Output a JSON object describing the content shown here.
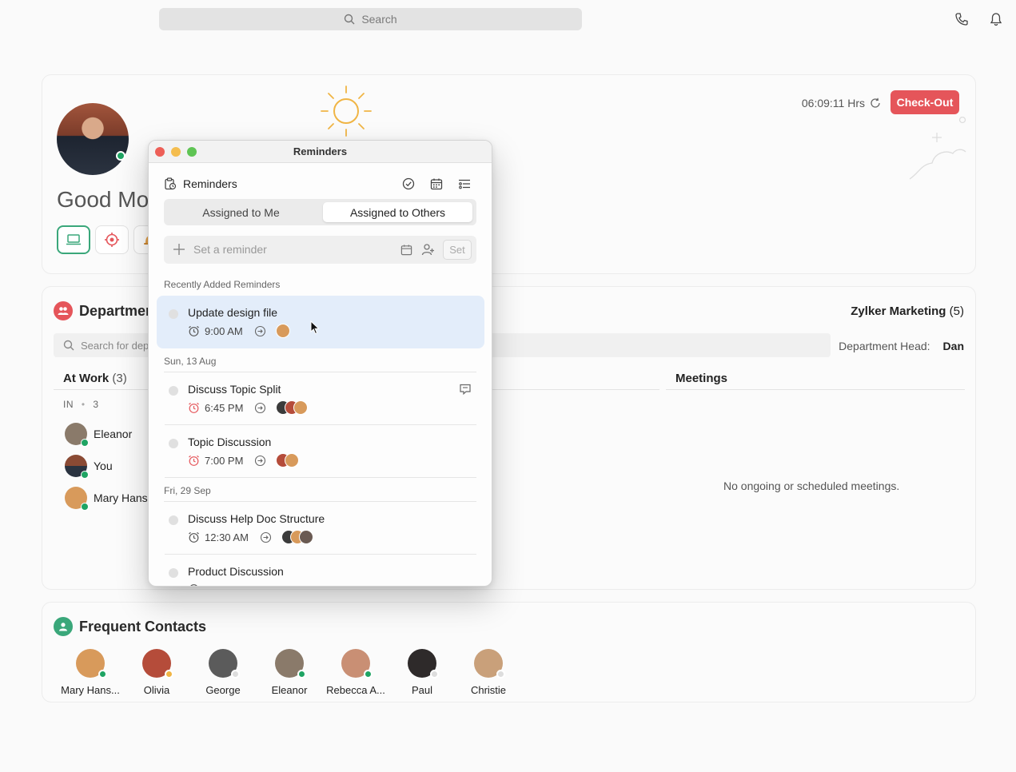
{
  "topbar": {
    "search_placeholder": "Search"
  },
  "home": {
    "greeting": "Good Mor",
    "timer": "06:09:11 Hrs",
    "checkout_label": "Check-Out"
  },
  "department": {
    "title": "Departmen",
    "name": "Zylker Marketing",
    "count": "(5)",
    "search_placeholder": "Search for depa",
    "head_label": "Department Head:",
    "head_name": "Dan",
    "at_work_label": "At Work",
    "at_work_count": "(3)",
    "in_label": "IN",
    "in_count": "3",
    "members": [
      {
        "name": "Eleanor"
      },
      {
        "name": "You"
      },
      {
        "name": "Mary Hansl"
      }
    ],
    "meetings_label": "Meetings",
    "no_meetings": "No ongoing or scheduled meetings."
  },
  "frequent_contacts": {
    "title": "Frequent Contacts",
    "contacts": [
      {
        "name": "Mary Hans...",
        "color": "#d89a5b"
      },
      {
        "name": "Olivia",
        "color": "#b54c3a"
      },
      {
        "name": "George",
        "color": "#5b5b5b"
      },
      {
        "name": "Eleanor",
        "color": "#8a7a6a"
      },
      {
        "name": "Rebecca A...",
        "color": "#c98f74"
      },
      {
        "name": "Paul",
        "color": "#2e2a2a"
      },
      {
        "name": "Christie",
        "color": "#c9a07a"
      }
    ]
  },
  "reminders": {
    "window_title": "Reminders",
    "header_label": "Reminders",
    "tab_me": "Assigned to Me",
    "tab_others": "Assigned to Others",
    "set_placeholder": "Set a reminder",
    "set_button": "Set",
    "recent_label": "Recently Added Reminders",
    "recent": {
      "title": "Update design file",
      "time": "9:00 AM"
    },
    "groups": [
      {
        "date": "Sun, 13 Aug",
        "items": [
          {
            "title": "Discuss Topic Split",
            "time": "6:45 PM"
          },
          {
            "title": "Topic Discussion",
            "time": "7:00 PM"
          }
        ]
      },
      {
        "date": "Fri, 29 Sep",
        "items": [
          {
            "title": "Discuss Help Doc Structure",
            "time": "12:30 AM"
          },
          {
            "title": "Product Discussion",
            "time": ""
          }
        ]
      }
    ]
  },
  "colors": {
    "accent_red": "#e5555a",
    "accent_green": "#3aa77a",
    "highlight": "#e3edfa"
  }
}
